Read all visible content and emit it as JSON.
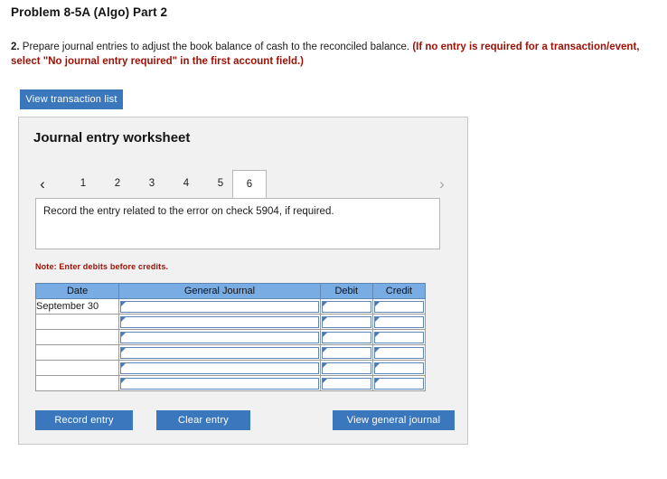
{
  "page": {
    "title": "Problem 8-5A (Algo) Part 2"
  },
  "instruction": {
    "step_number": "2.",
    "text": "Prepare journal entries to adjust the book balance of cash to the reconciled balance.",
    "red_note": "(If no entry is required for a transaction/event, select \"No journal entry required\" in the first account field.)"
  },
  "toolbar": {
    "view_transaction_list_label": "View transaction list"
  },
  "worksheet": {
    "title": "Journal entry worksheet",
    "nav": {
      "prev_icon": "chevron-left-icon",
      "next_icon": "chevron-right-icon",
      "prev_glyph": "‹",
      "next_glyph": "›"
    },
    "tabs": [
      {
        "label": "1",
        "selected": false
      },
      {
        "label": "2",
        "selected": false
      },
      {
        "label": "3",
        "selected": false
      },
      {
        "label": "4",
        "selected": false
      },
      {
        "label": "5",
        "selected": false
      },
      {
        "label": "6",
        "selected": true
      }
    ],
    "prompt": "Record the entry related to the error on check 5904, if required.",
    "debit_note": "Note: Enter debits before credits.",
    "table": {
      "columns": [
        "Date",
        "General Journal",
        "Debit",
        "Credit"
      ],
      "rows": [
        {
          "date": "September 30",
          "general_journal": "",
          "debit": "",
          "credit": ""
        },
        {
          "date": "",
          "general_journal": "",
          "debit": "",
          "credit": ""
        },
        {
          "date": "",
          "general_journal": "",
          "debit": "",
          "credit": ""
        },
        {
          "date": "",
          "general_journal": "",
          "debit": "",
          "credit": ""
        },
        {
          "date": "",
          "general_journal": "",
          "debit": "",
          "credit": ""
        },
        {
          "date": "",
          "general_journal": "",
          "debit": "",
          "credit": ""
        }
      ]
    },
    "buttons": {
      "record_entry": "Record entry",
      "clear_entry": "Clear entry",
      "view_general_journal": "View general journal"
    }
  },
  "colors": {
    "button_blue": "#3b77bd",
    "table_header_blue": "#7aace4",
    "red_note": "#9c1006",
    "panel_background": "#f1f1f1"
  }
}
